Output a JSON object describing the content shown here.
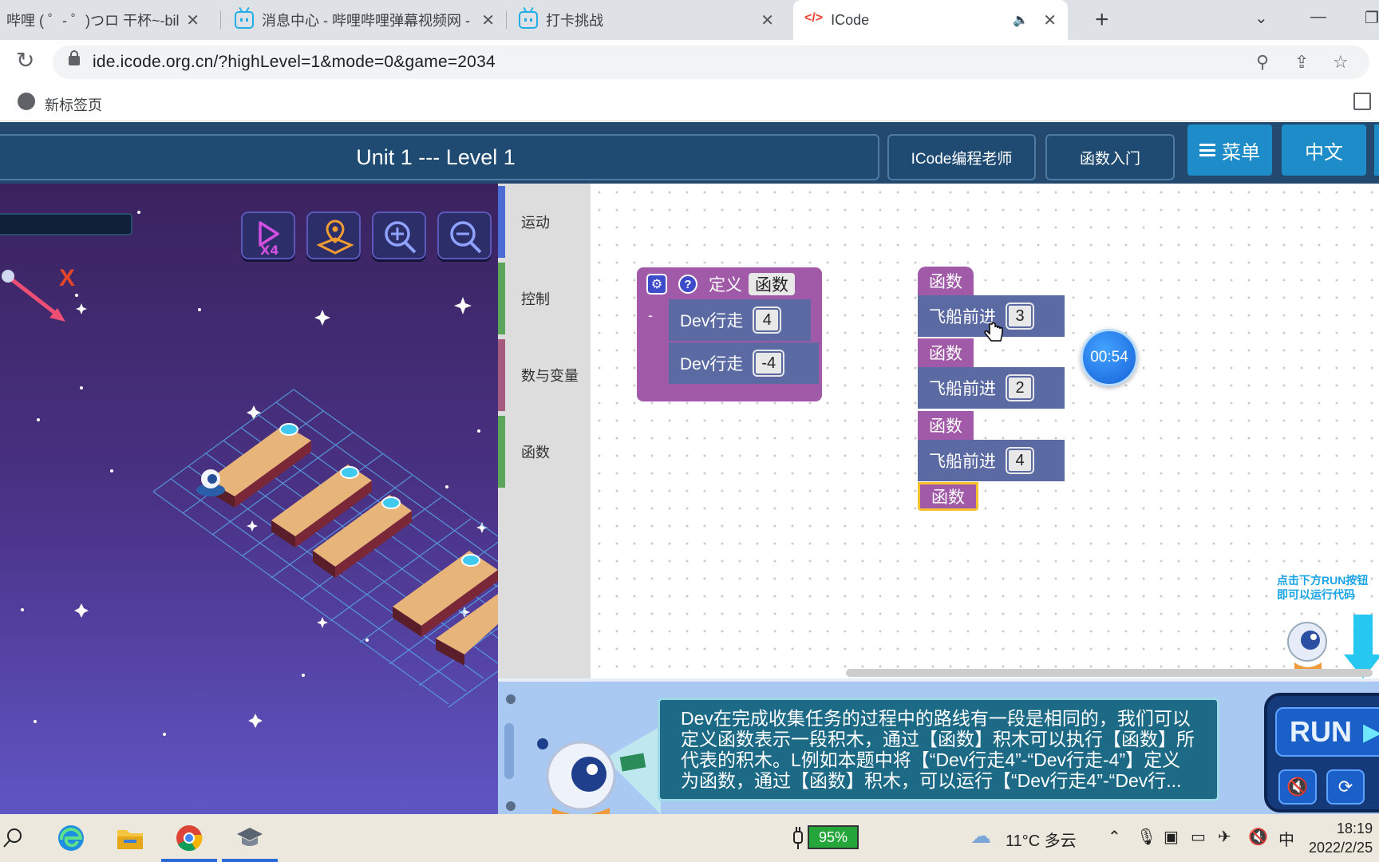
{
  "browser": {
    "tabs": [
      {
        "title": "哔哩 ( ゜- ゜)つロ 干杯~-bilil"
      },
      {
        "title": "消息中心 - 哔哩哔哩弹幕视频网 -"
      },
      {
        "title": "打卡挑战"
      },
      {
        "title": "ICode"
      }
    ],
    "url": "ide.icode.org.cn/?highLevel=1&mode=0&game=2034",
    "bookmark": "新标签页"
  },
  "header": {
    "level_title": "Unit 1 --- Level 1",
    "teacher_button": "ICode编程老师",
    "course_button": "函数入门",
    "menu_button": "菜单",
    "language_button": "中文"
  },
  "scene": {
    "axis_label": "X"
  },
  "palette": {
    "categories": [
      {
        "label": "运动",
        "color": "#4a6cd4"
      },
      {
        "label": "控制",
        "color": "#5ba55b"
      },
      {
        "label": "数与变量",
        "color": "#a55b80"
      },
      {
        "label": "函数",
        "color": "#5ba55b"
      }
    ]
  },
  "workspace": {
    "define_block": {
      "keyword": "定义",
      "name": "函数",
      "minus": "-",
      "body": [
        {
          "label": "Dev行走",
          "value": "4"
        },
        {
          "label": "Dev行走",
          "value": "-4"
        }
      ]
    },
    "main_program": {
      "call_label": "函数",
      "moves": [
        {
          "label": "飞船前进",
          "value": "3"
        },
        {
          "label": "飞船前进",
          "value": "2"
        },
        {
          "label": "飞船前进",
          "value": "4"
        }
      ]
    },
    "timer": "00:54",
    "run_hint_line1": "点击下方RUN按钮",
    "run_hint_line2": "即可以运行代码"
  },
  "instruction": {
    "text": "Dev在完成收集任务的过程中的路线有一段是相同的，我们可以定义函数表示一段积木，通过【函数】积木可以执行【函数】所代表的积木。L例如本题中将【“Dev行走4”-“Dev行走-4”】定义为函数，通过【函数】积木，可以运行【“Dev行走4”-“Dev行..."
  },
  "run_panel": {
    "run_label": "RUN"
  },
  "taskbar": {
    "battery": "95%",
    "weather": "11°C  多云",
    "ime": "中",
    "time": "18:19",
    "date": "2022/2/25"
  }
}
